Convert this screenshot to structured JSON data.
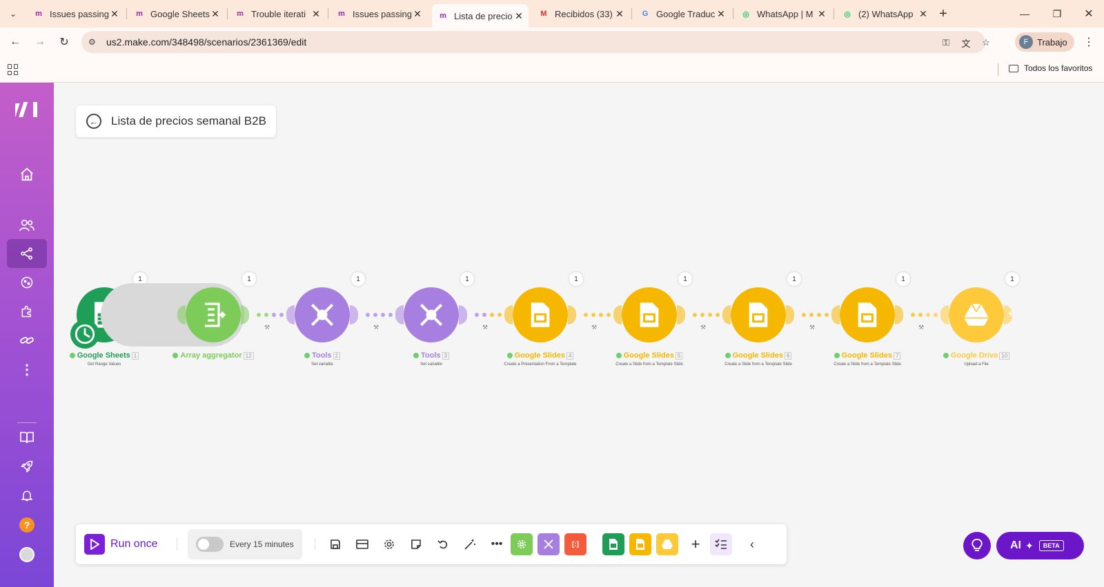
{
  "browser": {
    "tabs": [
      {
        "title": "Issues passing",
        "favicon": "make-icon",
        "color": "#9c27b0"
      },
      {
        "title": "Google Sheets",
        "favicon": "make-icon",
        "color": "#9c27b0"
      },
      {
        "title": "Trouble iterati",
        "favicon": "make-icon",
        "color": "#9c27b0"
      },
      {
        "title": "Issues passing",
        "favicon": "make-icon",
        "color": "#9c27b0"
      },
      {
        "title": "Lista de precio",
        "favicon": "make-icon",
        "color": "#9c27b0"
      },
      {
        "title": "Recibidos (33)",
        "favicon": "gmail-icon",
        "color": "#d93025"
      },
      {
        "title": "Google Traduc",
        "favicon": "translate-icon",
        "color": "#4285f4"
      },
      {
        "title": "WhatsApp | M",
        "favicon": "whatsapp-icon",
        "color": "#25d366"
      },
      {
        "title": "(2) WhatsApp",
        "favicon": "whatsapp-icon",
        "color": "#25d366"
      }
    ],
    "active_tab": 4,
    "url": "us2.make.com/348498/scenarios/2361369/edit",
    "profile": {
      "initial": "F",
      "label": "Trabajo"
    },
    "bookmarks": {
      "all_label": "Todos los favoritos"
    }
  },
  "scenario": {
    "title": "Lista de precios semanal B2B",
    "modules": [
      {
        "name": "Google Sheets",
        "num": "1",
        "sub": "Get Range Values",
        "icon": "sheets-icon",
        "color": "#1e9e57",
        "badge": "1"
      },
      {
        "name": "Array aggregator",
        "num": "12",
        "sub": "",
        "icon": "aggregator-icon",
        "color": "#7dcc5a",
        "badge": "1"
      },
      {
        "name": "Tools",
        "num": "2",
        "sub": "Set variable",
        "icon": "tools-icon",
        "color": "#a77fe0",
        "badge": "1"
      },
      {
        "name": "Tools",
        "num": "3",
        "sub": "Set variable",
        "icon": "tools-icon",
        "color": "#a77fe0",
        "badge": "1"
      },
      {
        "name": "Google Slides",
        "num": "4",
        "sub": "Create a Presentation From a Template",
        "icon": "slides-icon",
        "color": "#f6b700",
        "badge": "1"
      },
      {
        "name": "Google Slides",
        "num": "5",
        "sub": "Create a Slide from a Template Slide",
        "icon": "slides-icon",
        "color": "#f6b700",
        "badge": "1"
      },
      {
        "name": "Google Slides",
        "num": "6",
        "sub": "Create a Slide from a Template Slide",
        "icon": "slides-icon",
        "color": "#f6b700",
        "badge": "1"
      },
      {
        "name": "Google Slides",
        "num": "7",
        "sub": "Create a Slide from a Template Slide",
        "icon": "slides-icon",
        "color": "#f6b700",
        "badge": "1"
      },
      {
        "name": "Google Drive",
        "num": "10",
        "sub": "Upload a File",
        "icon": "drive-icon",
        "color": "#ffc93c",
        "badge": "1"
      }
    ]
  },
  "toolbar": {
    "run_label": "Run once",
    "schedule_label": "Every 15 minutes",
    "ai_label": "AI",
    "beta_label": "BETA"
  },
  "colors": {
    "accent": "#6b17c9",
    "sidebar_top": "#c35ec9",
    "sidebar_bottom": "#7b46d6"
  }
}
